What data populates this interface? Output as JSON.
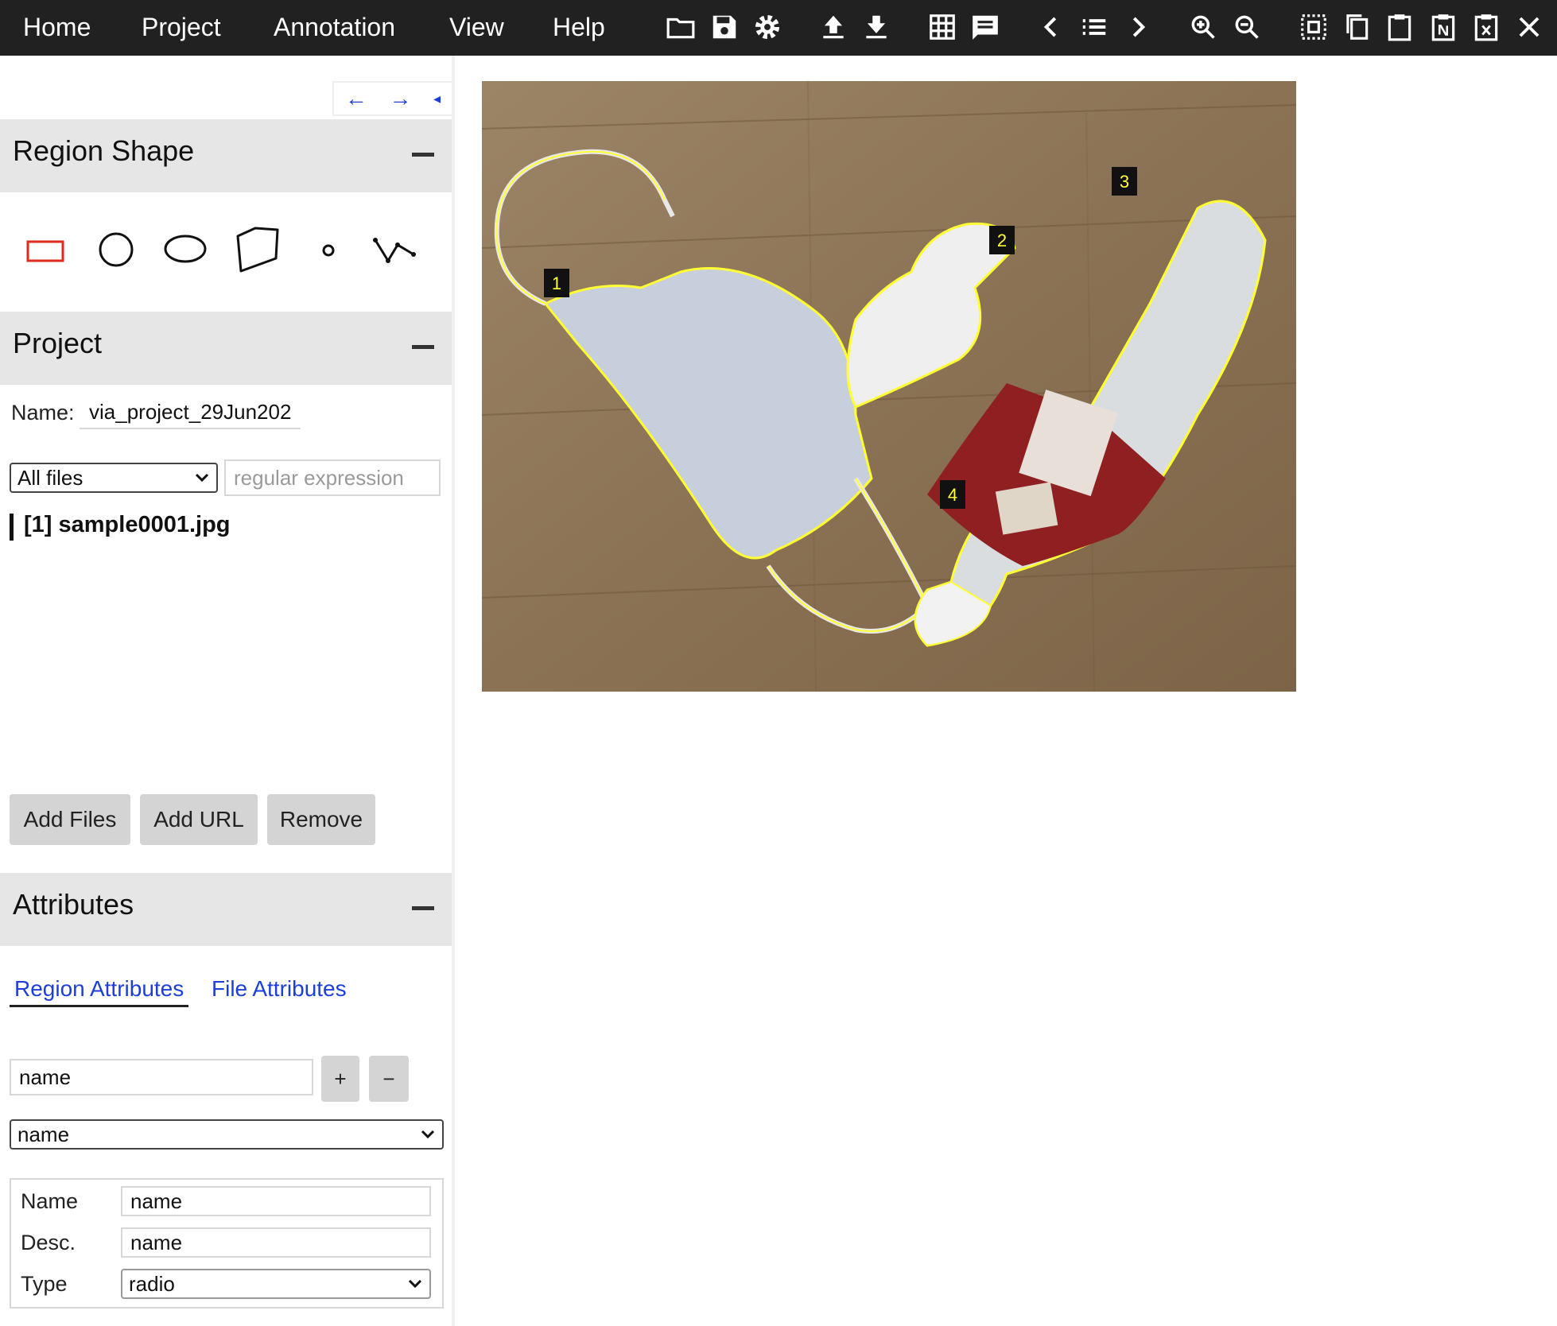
{
  "topbar": {
    "menus": [
      "Home",
      "Project",
      "Annotation",
      "View",
      "Help"
    ],
    "icons": [
      "open-folder-icon",
      "save-icon",
      "settings-icon",
      "upload-icon",
      "download-icon",
      "grid-view-icon",
      "comment-icon",
      "prev-image-icon",
      "list-icon",
      "next-image-icon",
      "zoom-in-icon",
      "zoom-out-icon",
      "select-all-icon",
      "copy-icon",
      "paste-icon",
      "paste-n-icon",
      "delete-region-icon",
      "close-icon"
    ]
  },
  "panel_nav": {
    "left": "←",
    "right": "→",
    "collapse": "◂"
  },
  "region_shape": {
    "title": "Region Shape",
    "shapes": [
      "rectangle-shape-icon",
      "circle-shape-icon",
      "ellipse-shape-icon",
      "polygon-shape-icon",
      "point-shape-icon",
      "polyline-shape-icon"
    ],
    "active_color": "#e0291b"
  },
  "project": {
    "title": "Project",
    "name_label": "Name:",
    "name_value": "via_project_29Jun202",
    "filter_select": "All files",
    "regex_placeholder": "regular expression",
    "files": [
      "[1] sample0001.jpg"
    ],
    "buttons": {
      "add_files": "Add Files",
      "add_url": "Add URL",
      "remove": "Remove"
    }
  },
  "attributes": {
    "title": "Attributes",
    "tabs": {
      "region": "Region Attributes",
      "file": "File Attributes"
    },
    "new_attr_value": "name",
    "add_label": "+",
    "remove_label": "−",
    "attr_select": "name",
    "fields": {
      "name_label": "Name",
      "name_value": "name",
      "desc_label": "Desc.",
      "desc_value": "name",
      "type_label": "Type",
      "type_value": "radio"
    }
  },
  "image": {
    "region_labels": [
      "1",
      "2",
      "3",
      "4"
    ],
    "region_outline_color": "#ffff33"
  }
}
